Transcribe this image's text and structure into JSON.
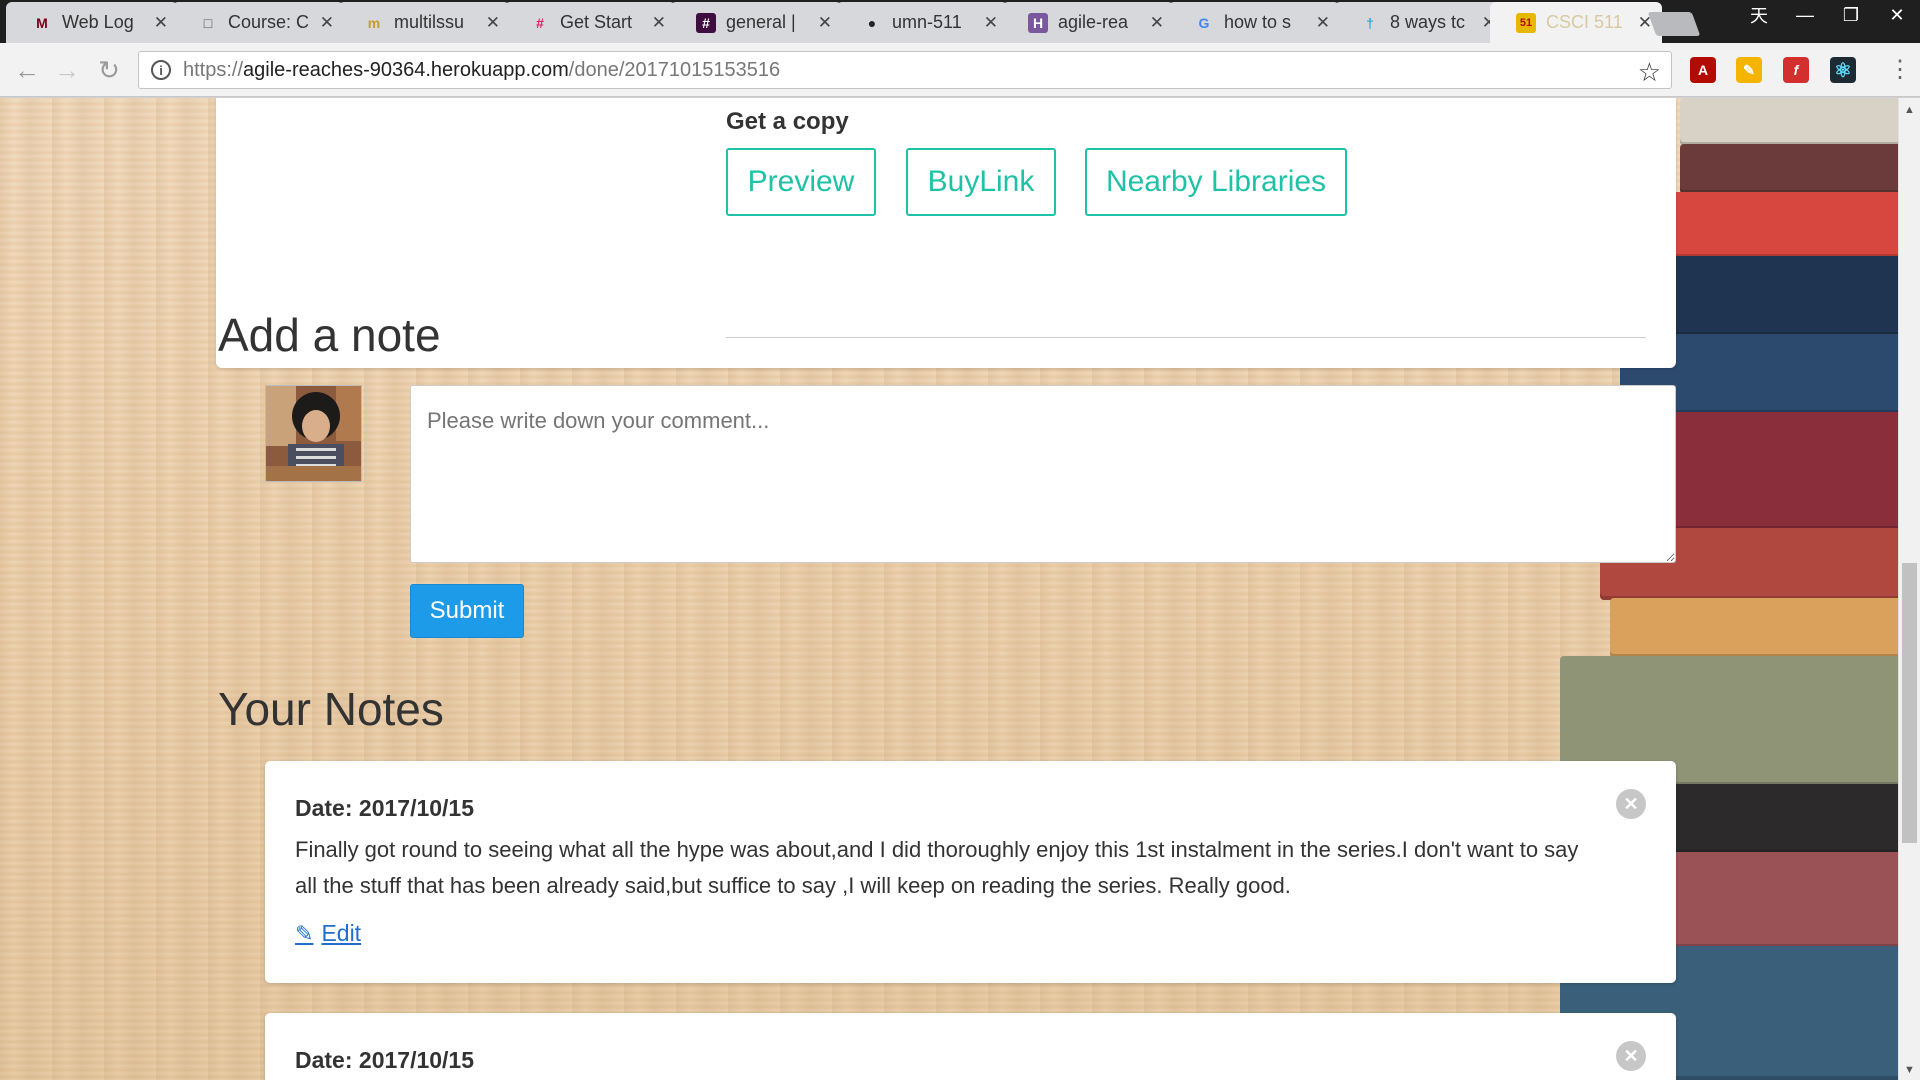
{
  "browser": {
    "tabs": [
      {
        "title": "Web Log",
        "favicon": "M",
        "favicon_color": "#7a0019",
        "left": 0
      },
      {
        "title": "Course: C",
        "favicon": "□",
        "favicon_color": "#555555"
      },
      {
        "title": "multilssu",
        "favicon": "m",
        "favicon_color": "#c79b2c"
      },
      {
        "title": "Get Start",
        "favicon": "#",
        "favicon_color": "#e01e5a"
      },
      {
        "title": "general |",
        "favicon": "#",
        "favicon_color": "#3f0e40"
      },
      {
        "title": "umn-511",
        "favicon": "●",
        "favicon_color": "#222222"
      },
      {
        "title": "agile-rea",
        "favicon": "H",
        "favicon_color": "#79589f"
      },
      {
        "title": "how to s",
        "favicon": "G",
        "favicon_color": "#4285f4"
      },
      {
        "title": "8 ways tc",
        "favicon": "†",
        "favicon_color": "#2ca8e0"
      },
      {
        "title": "CSCI 511",
        "favicon": "51",
        "favicon_color": "#e6b800"
      }
    ],
    "window_controls": {
      "ime": "天",
      "minimize": "—",
      "restore": "❐",
      "close": "✕"
    },
    "url_scheme": "https://",
    "url_host": "agile-reaches-90364.herokuapp.com",
    "url_path": "/done/20171015153516",
    "extensions": [
      {
        "name": "pdf-icon",
        "glyph": "A",
        "color": "#b30b00"
      },
      {
        "name": "keep-icon",
        "glyph": "✎",
        "color": "#f4b400"
      },
      {
        "name": "flash-icon",
        "glyph": "f",
        "color": "#d32f2f"
      },
      {
        "name": "react-icon",
        "glyph": "⚛",
        "color": "#1e8aa8"
      }
    ]
  },
  "copy_section": {
    "heading": "Get a copy",
    "buttons": [
      "Preview",
      "BuyLink",
      "Nearby Libraries"
    ]
  },
  "add_note": {
    "heading": "Add a note",
    "placeholder": "Please write down your comment...",
    "submit_label": "Submit"
  },
  "notes": {
    "heading": "Your Notes",
    "items": [
      {
        "date": "Date: 2017/10/15",
        "text": "Finally got round to seeing what all the hype was about,and I did thoroughly enjoy this 1st instalment in the series.I don't want to say all the stuff that has been already said,but suffice to say ,I will keep on reading the series. Really good.",
        "edit_label": "Edit"
      },
      {
        "date": "Date: 2017/10/15",
        "text": "",
        "edit_label": ""
      }
    ]
  },
  "colors": {
    "accent_teal": "#1fc2a7",
    "submit_blue": "#1e9be8",
    "link_blue": "#1f6fd1"
  }
}
